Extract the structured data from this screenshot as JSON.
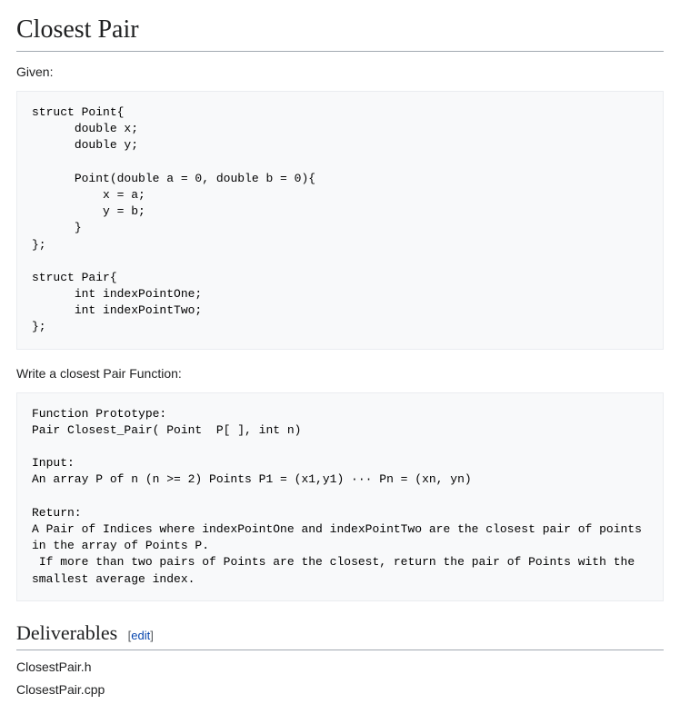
{
  "title": "Closest Pair",
  "given_label": "Given:",
  "code_block_1": "struct Point{\n      double x;\n      double y;\n\n      Point(double a = 0, double b = 0){\n          x = a;\n          y = b;\n      }\n};\n\nstruct Pair{\n      int indexPointOne;\n      int indexPointTwo;\n};",
  "write_label": "Write a closest Pair Function:",
  "code_block_2": "Function Prototype:\nPair Closest_Pair( Point  P[ ], int n)\n\nInput:\nAn array P of n (n >= 2) Points P1 = (x1,y1) ··· Pn = (xn, yn)\n\nReturn:\nA Pair of Indices where indexPointOne and indexPointTwo are the closest pair of points in the array of Points P.\n If more than two pairs of Points are the closest, return the pair of Points with the smallest average index.",
  "deliverables_heading": "Deliverables",
  "edit_label": "edit",
  "deliverables": {
    "item_1": "ClosestPair.h",
    "item_2": "ClosestPair.cpp"
  }
}
